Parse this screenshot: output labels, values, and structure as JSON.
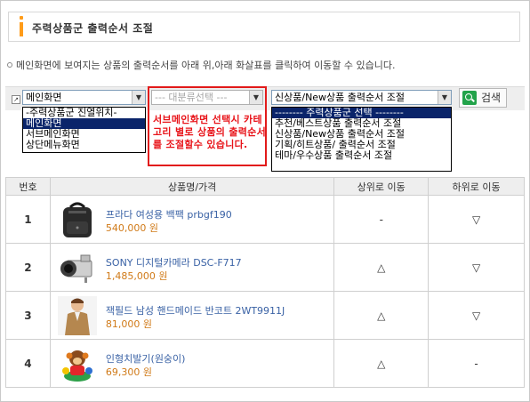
{
  "header": {
    "title": "주력상품군 출력순서 조절"
  },
  "description": "메인화면에 보여지는 상품의 출력순서를 아래 위,아래 화살표를 클릭하여 이동할 수 있습니다.",
  "controls": {
    "location_select": {
      "value": "메인화면",
      "options": [
        "-주력상품군 진열위치-",
        "메인화면",
        "서브메인화면",
        "상단메뉴화면"
      ],
      "selected_index": 1
    },
    "category_select": {
      "value": "--- 대분류선택 ---"
    },
    "group_select": {
      "value": "신상품/New상품 출력순서 조절",
      "options": [
        "-------- 주력상품군 선택 --------",
        "추천/베스트상품 출력순서 조절",
        "신상품/New상품 출력순서 조절",
        "기획/히트상품/ 출력순서 조절",
        "테마/우수상품 출력순서 조절"
      ],
      "selected_index": 0
    },
    "notice": "서브메인화면 선택시 카테고리 별로 상품의 출력순서를 조절할수 있습니다.",
    "search_label": "검색"
  },
  "table": {
    "headers": {
      "no": "번호",
      "product": "상품명/가격",
      "up": "상위로 이동",
      "down": "하위로 이동"
    },
    "rows": [
      {
        "no": "1",
        "name": "프라다 여성용 백팩 prbgf190",
        "price": "540,000 원",
        "up": "-",
        "down": "▽",
        "image": "backpack"
      },
      {
        "no": "2",
        "name": "SONY 디지털카메라 DSC-F717",
        "price": "1,485,000 원",
        "up": "△",
        "down": "▽",
        "image": "camera"
      },
      {
        "no": "3",
        "name": "잭필드 남성 핸드메이드 반코트 2WT9911J",
        "price": "81,000 원",
        "up": "△",
        "down": "▽",
        "image": "coat-model"
      },
      {
        "no": "4",
        "name": "인형치발기(원숭이)",
        "price": "69,300 원",
        "up": "△",
        "down": "-",
        "image": "monkey-toy"
      }
    ]
  }
}
